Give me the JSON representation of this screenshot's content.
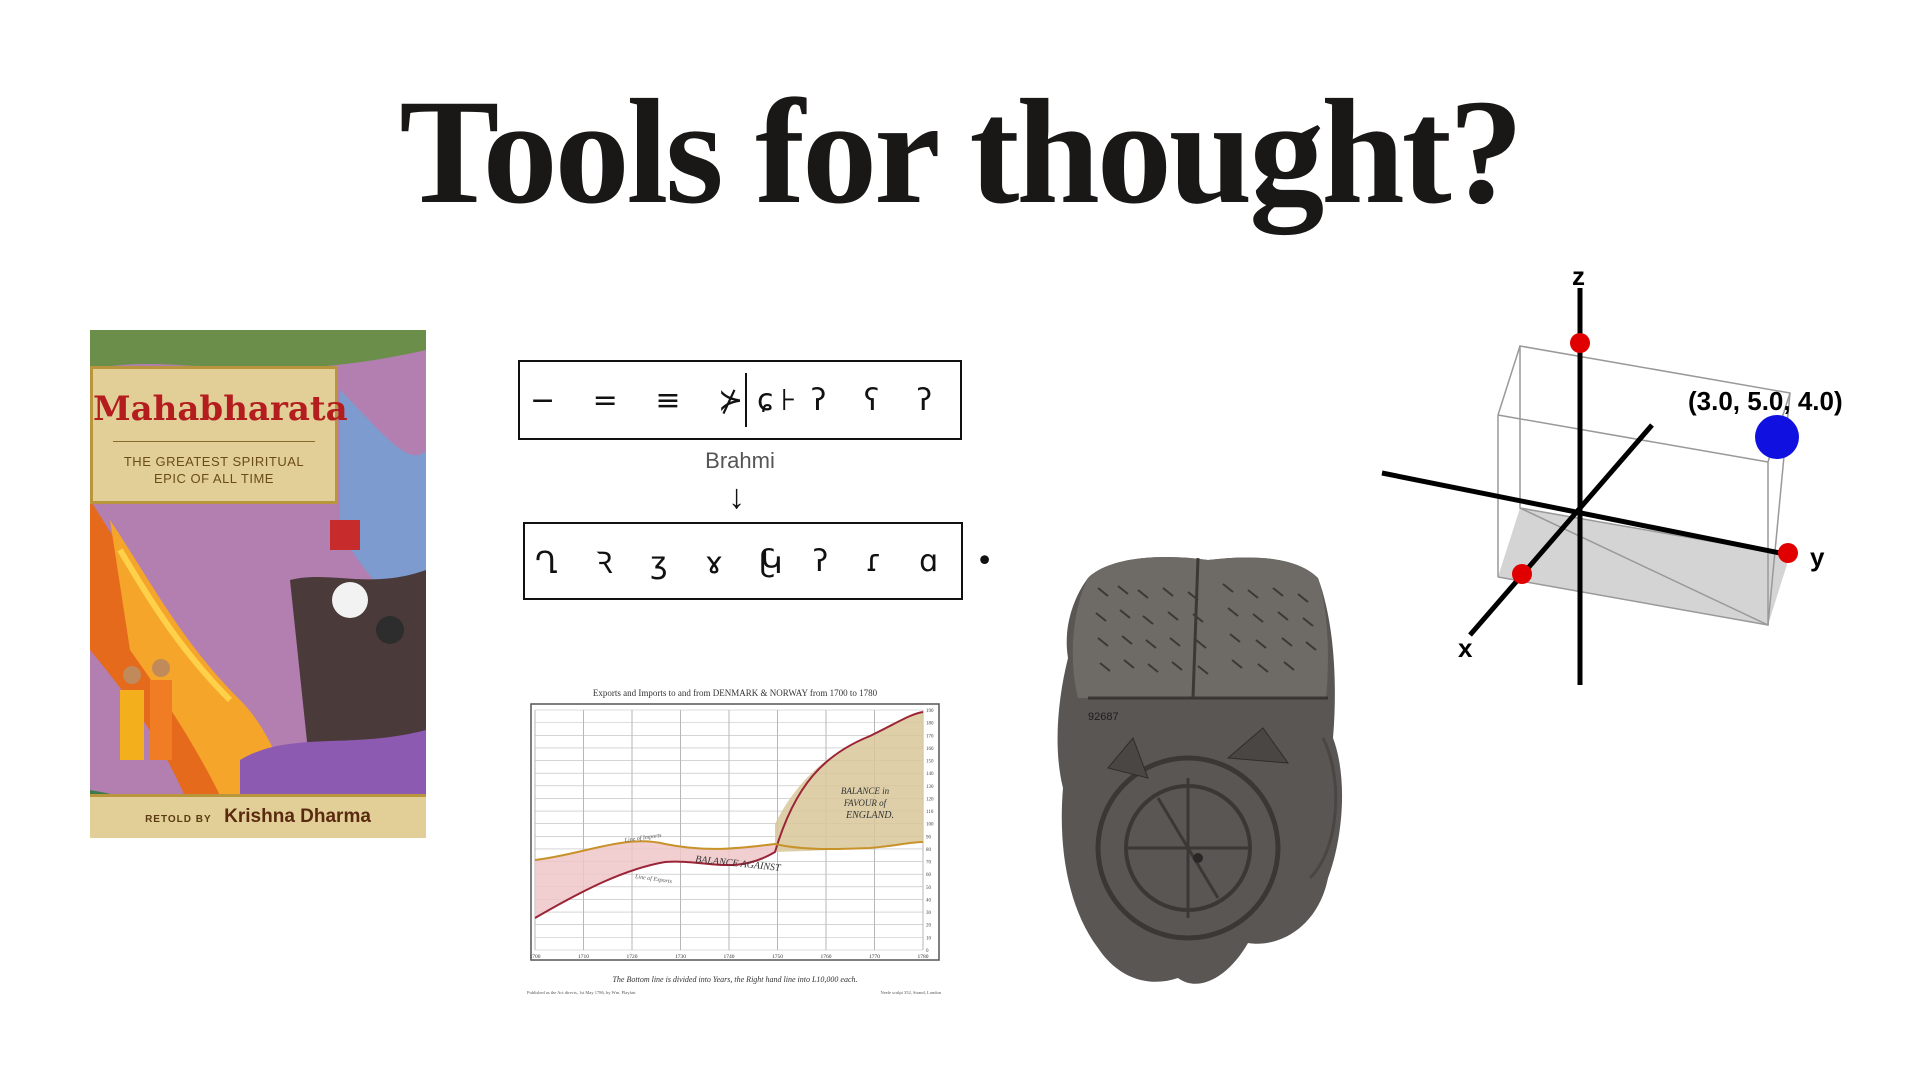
{
  "title": "Tools for thought?",
  "book": {
    "title": "Mahabharata",
    "subtitle_line1": "THE GREATEST SPIRITUAL",
    "subtitle_line2": "EPIC OF ALL TIME",
    "retold_by": "RETOLD BY",
    "author": "Krishna Dharma"
  },
  "numerals": {
    "brahmi_left": "− = ≡ ⊁ ⊦",
    "brahmi_right": "ɕ ʔ ʕ ʔ",
    "label": "Brahmi",
    "arrow": "↓",
    "hindu_left": "Ղ Ꝛ ʒ ɤ Կ",
    "hindu_right": "ʗ ʔ ɾ ɑ •"
  },
  "playfair": {
    "title": "Exports and Imports to and from DENMARK & NORWAY from 1700 to 1780",
    "years": [
      "1700",
      "1710",
      "1720",
      "1730",
      "1740",
      "1750",
      "1760",
      "1770",
      "1780"
    ],
    "right_ticks": [
      "190",
      "180",
      "170",
      "160",
      "150",
      "140",
      "130",
      "120",
      "110",
      "100",
      "90",
      "80",
      "70",
      "60",
      "50",
      "40",
      "30",
      "20",
      "10",
      "0"
    ],
    "label_against": "BALANCE AGAINST",
    "label_favour_1": "BALANCE in",
    "label_favour_2": "FAVOUR of",
    "label_favour_3": "ENGLAND.",
    "line_label_imports": "Line of Imports",
    "line_label_exports": "Line of Exports",
    "caption": "The Bottom line is divided into Years, the Right hand line into L10,000 each.",
    "footer_left": "Published as the Act directs, 1st May 1786, by Wm. Playfair",
    "footer_right": "Neele sculpt 352, Strand, London"
  },
  "tablet": {
    "label": "92687"
  },
  "plot3d": {
    "axis_z": "z",
    "axis_y": "y",
    "axis_x": "x",
    "point_label": "(3.0, 5.0, 4.0)",
    "colors": {
      "point": "#1010e0",
      "marker": "#e00000"
    }
  }
}
